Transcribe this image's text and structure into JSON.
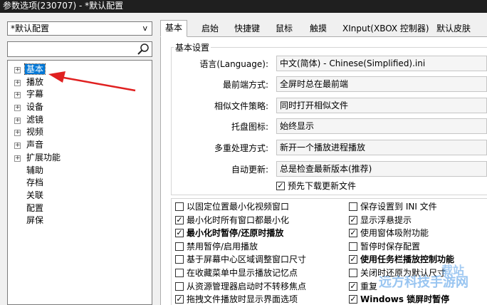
{
  "window": {
    "title": "参数选项(230707) - *默认配置"
  },
  "profile_select": {
    "value": "*默认配置",
    "chevron": "v"
  },
  "search": {
    "value": "",
    "icon": "search-icon"
  },
  "tree": [
    {
      "label": "基本",
      "expandable": true,
      "selected": true
    },
    {
      "label": "播放",
      "expandable": true
    },
    {
      "label": "字幕",
      "expandable": true
    },
    {
      "label": "设备",
      "expandable": true
    },
    {
      "label": "滤镜",
      "expandable": true
    },
    {
      "label": "视频",
      "expandable": true
    },
    {
      "label": "声音",
      "expandable": true
    },
    {
      "label": "扩展功能",
      "expandable": true
    },
    {
      "label": "辅助",
      "expandable": false
    },
    {
      "label": "存档",
      "expandable": false
    },
    {
      "label": "关联",
      "expandable": false
    },
    {
      "label": "配置",
      "expandable": false
    },
    {
      "label": "屏保",
      "expandable": false
    }
  ],
  "tabs": [
    "基本",
    "启始",
    "快捷键",
    "鼠标",
    "触摸",
    "XInput(XBOX 控制器)",
    "默认皮肤"
  ],
  "basic": {
    "group_title": "基本设置",
    "rows": [
      {
        "label": "语言(Language):",
        "value": "中文(简体) - Chinese(Simplified).ini"
      },
      {
        "label": "最前端方式:",
        "value": "全屏时总在最前端"
      },
      {
        "label": "相似文件策略:",
        "value": "同时打开相似文件"
      },
      {
        "label": "托盘图标:",
        "value": "始终显示"
      },
      {
        "label": "多重处理方式:",
        "value": "新开一个播放进程播放"
      },
      {
        "label": "自动更新:",
        "value": "总是检查最新版本(推荐)"
      }
    ],
    "prerelease_check": {
      "label": "预先下载更新文件",
      "checked": true
    }
  },
  "checks_left": [
    {
      "label": "以固定位置最小化视频窗口",
      "checked": false,
      "bold": false
    },
    {
      "label": "最小化时所有窗口都最小化",
      "checked": true,
      "bold": false
    },
    {
      "label": "最小化时暂停/还原时播放",
      "checked": true,
      "bold": true
    },
    {
      "label": "禁用暂停/启用播放",
      "checked": false,
      "bold": false
    },
    {
      "label": "基于屏幕中心区域调整窗口尺寸",
      "checked": false,
      "bold": false
    },
    {
      "label": "在收藏菜单中显示播放记忆点",
      "checked": false,
      "bold": false
    },
    {
      "label": "从资源管理器启动时不转移焦点",
      "checked": false,
      "bold": false
    },
    {
      "label": "拖拽文件播放时显示界面选项",
      "checked": true,
      "bold": false
    }
  ],
  "checks_right": [
    {
      "label": "保存设置到 INI 文件",
      "checked": false,
      "bold": false
    },
    {
      "label": "显示浮悬提示",
      "checked": true,
      "bold": false
    },
    {
      "label": "使用窗体吸附功能",
      "checked": true,
      "bold": false
    },
    {
      "label": "暂停时保存配置",
      "checked": false,
      "bold": false
    },
    {
      "label": "使用任务栏播放控制功能",
      "checked": true,
      "bold": true
    },
    {
      "label": "关闭时还原为默认尺寸",
      "checked": false,
      "bold": false
    },
    {
      "label": "重复",
      "checked": true,
      "bold": false
    },
    {
      "label": "Windows 锁屏时暂停",
      "checked": true,
      "bold": true
    }
  ],
  "watermark": {
    "line1": "载站",
    "line2": "远方科技手游网"
  },
  "colors": {
    "selection": "#0078d7",
    "arrow": "#e02020",
    "titlebar": "#1f1f1f"
  }
}
